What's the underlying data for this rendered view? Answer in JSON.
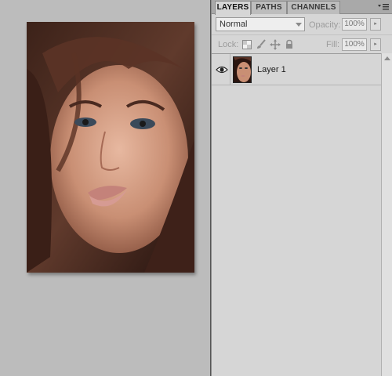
{
  "panel": {
    "tabs": [
      {
        "label": "LAYERS",
        "active": true
      },
      {
        "label": "PATHS",
        "active": false
      },
      {
        "label": "CHANNELS",
        "active": false
      }
    ],
    "menu_icon": "panel-menu-icon"
  },
  "blend": {
    "mode": "Normal",
    "opacity_label": "Opacity:",
    "opacity_value": "100%"
  },
  "lock": {
    "label": "Lock:",
    "icons": [
      "lock-transparent-pixels-icon",
      "lock-image-pixels-icon",
      "lock-position-icon",
      "lock-all-icon"
    ],
    "fill_label": "Fill:",
    "fill_value": "100%"
  },
  "layers": [
    {
      "name": "Layer 1",
      "visible": true,
      "thumbnail": "portrait-thumbnail"
    }
  ],
  "document": {
    "content": "portrait-photo"
  },
  "colors": {
    "panel_bg": "#d6d6d6",
    "canvas_bg": "#bcbcbc",
    "tabbar_bg": "#a9a9a9"
  }
}
